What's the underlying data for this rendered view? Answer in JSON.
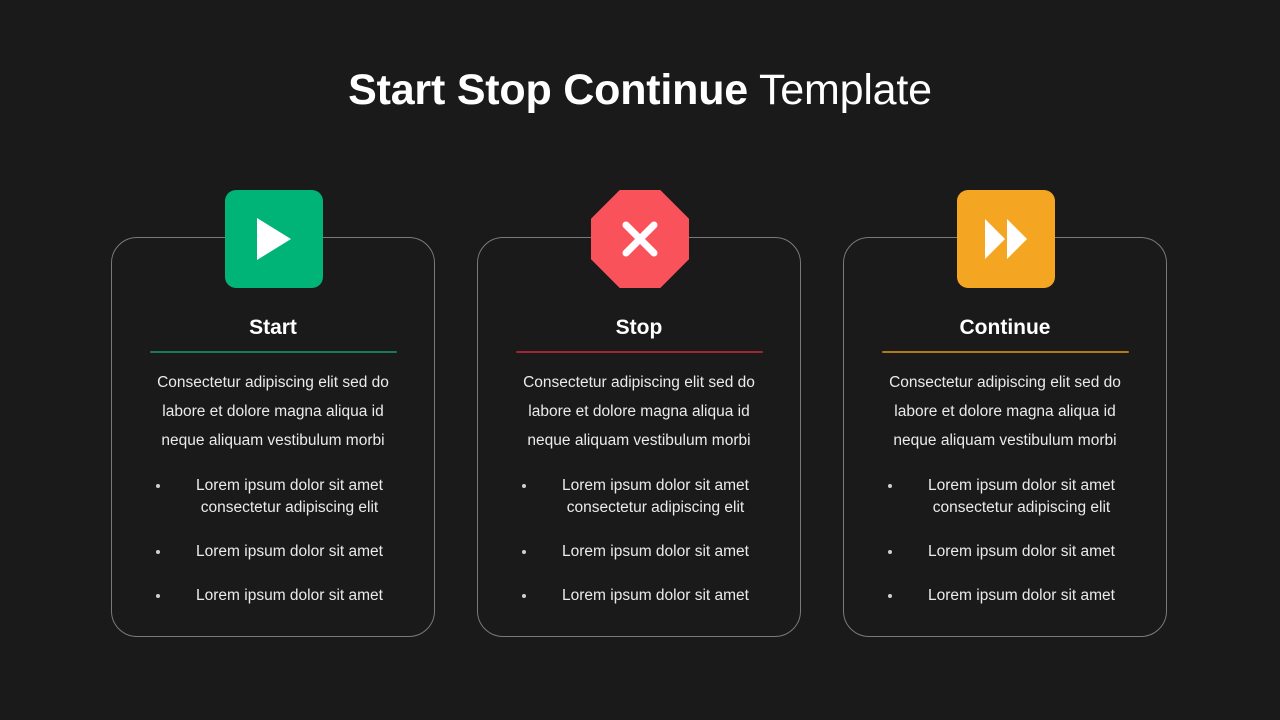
{
  "slide": {
    "background_color": "#1a1a1a",
    "title": {
      "bold_part": "Start Stop Continue",
      "light_part": " Template",
      "full": "Start Stop Continue Template"
    }
  },
  "cards": [
    {
      "id": "start",
      "title": "Start",
      "icon_name": "play-icon",
      "icon_shape": "rounded-square",
      "icon_bg_color": "#00b377",
      "icon_glyph_color": "#ffffff",
      "divider_color": "#1b7a52",
      "description": "Consectetur adipiscing elit sed do labore et dolore magna aliqua id neque aliquam vestibulum morbi",
      "bullets": [
        "Lorem ipsum dolor sit amet consectetur adipiscing elit",
        "Lorem ipsum dolor sit amet",
        "Lorem ipsum dolor sit amet"
      ]
    },
    {
      "id": "stop",
      "title": "Stop",
      "icon_name": "stop-x-icon",
      "icon_shape": "octagon",
      "icon_bg_color": "#f9525b",
      "icon_glyph_color": "#ffffff",
      "divider_color": "#9e2630",
      "description": "Consectetur adipiscing elit sed do labore et dolore magna aliqua id neque aliquam vestibulum morbi",
      "bullets": [
        "Lorem ipsum dolor sit amet consectetur adipiscing elit",
        "Lorem ipsum dolor sit amet",
        "Lorem ipsum dolor sit amet"
      ]
    },
    {
      "id": "continue",
      "title": "Continue",
      "icon_name": "fast-forward-icon",
      "icon_shape": "rounded-square",
      "icon_bg_color": "#f4a623",
      "icon_glyph_color": "#ffffff",
      "divider_color": "#b07a18",
      "description": "Consectetur adipiscing elit sed do labore et dolore magna aliqua id neque aliquam vestibulum morbi",
      "bullets": [
        "Lorem ipsum dolor sit amet consectetur adipiscing elit",
        "Lorem ipsum dolor sit amet",
        "Lorem ipsum dolor sit amet"
      ]
    }
  ]
}
